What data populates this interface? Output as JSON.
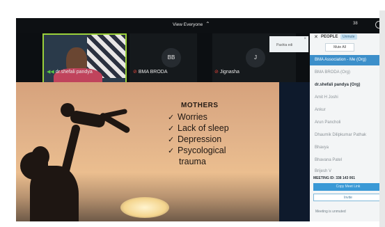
{
  "topbar": {
    "view_label": "View Everyone",
    "view_caret": "⌃"
  },
  "participants": [
    {
      "name": "dr.shefali pandya",
      "mic": "on"
    },
    {
      "name": "BMA BRODA",
      "initials": "BB",
      "mic": "off"
    },
    {
      "name": "Jignasha",
      "initials": "J",
      "mic": "off"
    }
  ],
  "popup": {
    "label": "Pashia edi",
    "close": "×"
  },
  "slide": {
    "title": "MOTHERS",
    "bullets": [
      "Worries",
      "Lack of sleep",
      "Depression",
      "Psycological"
    ],
    "continuation": "trauma",
    "check_glyph": "✓"
  },
  "panel": {
    "people_count": "38",
    "close": "✕",
    "title": "PEOPLE",
    "badge": "Unmute",
    "mute_button": "Mute All",
    "rows": [
      "BMA Association - Me (Org)",
      "BMA BRODA (Org)",
      "dr.shefali pandya (Org)",
      "Amit H Joshi",
      "Ankur",
      "Arun Pancholi",
      "Dhaumik Dilipkumar Pathak",
      "Bhavya",
      "Bhavana Patel",
      "Brijesh V"
    ],
    "meeting_id": "MEETING ID: 338 143 061",
    "join_button": "Copy Meet Link",
    "invite_button": "Invite",
    "unmute_note": "Meeting is unmuted"
  },
  "colors": {
    "accent": "#3c8fca",
    "mic_on": "#58c644",
    "mic_off": "#e2453c",
    "slide_text": "#1f1712"
  }
}
